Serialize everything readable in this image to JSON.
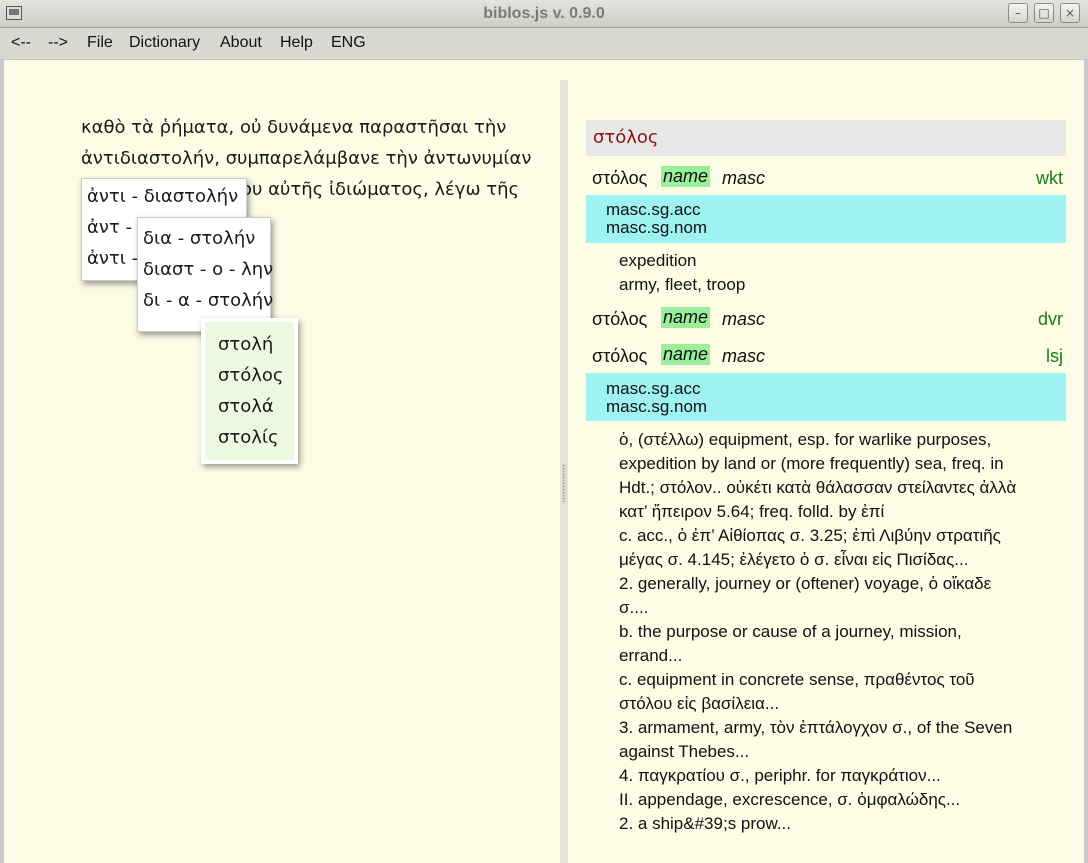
{
  "window": {
    "title": "biblos.js v. 0.9.0",
    "min": "–",
    "max": "□",
    "close": "×"
  },
  "menu": [
    "<--",
    "-->",
    "File",
    "Dictionary",
    "About",
    "Help",
    "ENG"
  ],
  "text_lines": [
    "καθὸ τὰ ῥήματα, οὐ δυνάμενα παραστῆσαι τὴν",
    "ἀντιδιαστολήν, συμπαρελάμβανε τὴν ἀντωνυμίαν",
    "ου αὐτῆς ἰδιώματος, λέγω τῆς"
  ],
  "popup1": [
    "ἀντι - διαστολήν",
    "ἀντ - ι",
    "ἀντι -"
  ],
  "popup2": [
    "δια - στολήν",
    "διαστ - ο - λην",
    "δι - α - στολήν"
  ],
  "popup3": [
    "στολή",
    "στόλος",
    "στολά",
    "στολίς"
  ],
  "dictionary": {
    "headword": "στόλος",
    "entries": [
      {
        "lemma": "στόλος",
        "pos": "name",
        "gender": "masc",
        "source": "wkt"
      },
      {
        "lemma": "στόλος",
        "pos": "name",
        "gender": "masc",
        "source": "dvr"
      },
      {
        "lemma": "στόλος",
        "pos": "name",
        "gender": "masc",
        "source": "lsj"
      }
    ],
    "morph1": [
      "masc.sg.acc",
      "masc.sg.nom"
    ],
    "wkt_defs": [
      "expedition",
      "army, fleet, troop"
    ],
    "morph2": [
      "masc.sg.acc",
      "masc.sg.nom"
    ],
    "lsj_defs": [
      "ὁ, (στέλλω) equipment, esp. for warlike purposes,",
      "expedition by land or (more frequently) sea, freq. in",
      "Hdt.; στόλον.. οὐκέτι κατὰ θάλασσαν στείλαντες ἀλλὰ",
      "κατ’ ἤπειρον 5.64; freq. folld. by ἐπί",
      "c. acc., ὁ ἐπ’ Αἰθίοπας σ. 3.25; ἐπὶ Λιβύην στρατιῆς",
      "μέγας σ. 4.145; ἐλέγετο ὁ σ. εἶναι εἰς Πισίδας...",
      "2. generally, journey or (oftener) voyage, ὁ οἴκαδε",
      "σ....",
      "b. the purpose or cause of a journey, mission,",
      "errand...",
      "c. equipment in concrete sense, πραθέντος τοῦ",
      "στόλου εἰς βασίλεια...",
      "3. armament, army, τὸν ἑπτάλογχον σ., of the Seven",
      "against Thebes...",
      "4. παγκρατίου σ., periphr. for παγκράτιον...",
      "II. appendage, excrescence, σ. ὀμφαλώδης...",
      "2. a ship&#39;s prow..."
    ]
  }
}
